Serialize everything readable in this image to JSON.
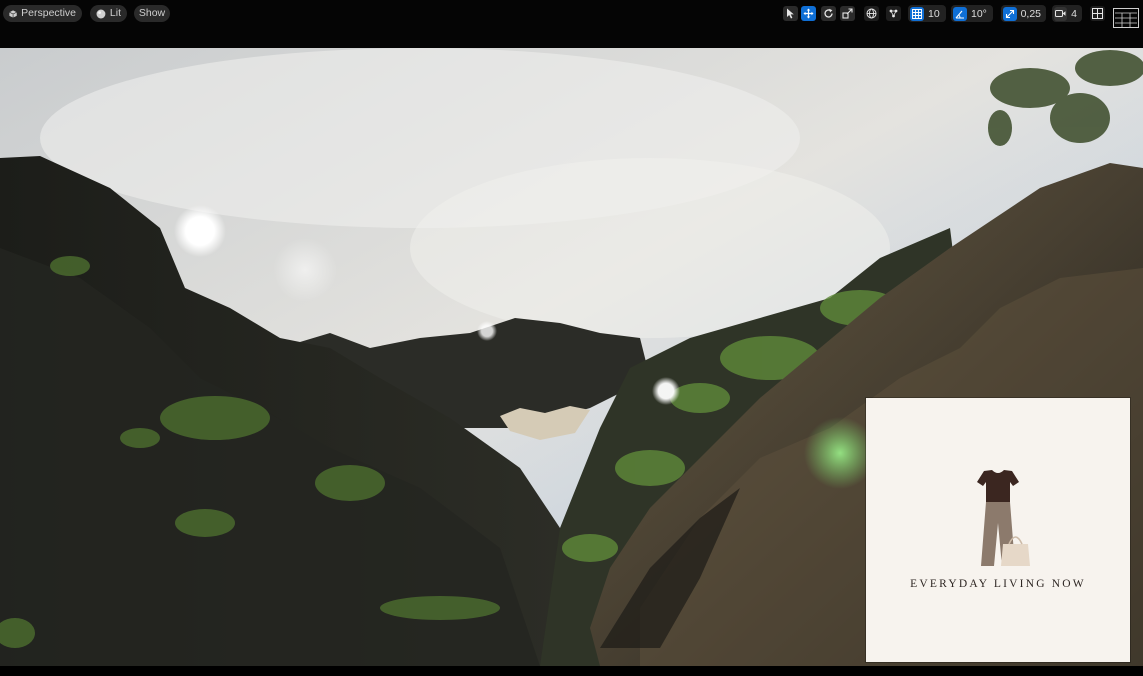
{
  "toolbar": {
    "view_mode": {
      "label": "Perspective",
      "icon": "cube-icon"
    },
    "lighting_mode": {
      "label": "Lit",
      "icon": "sphere-icon"
    },
    "show_menu": {
      "label": "Show"
    },
    "transform_tools": [
      "select-icon",
      "move-icon",
      "rotate-icon",
      "scale-icon"
    ],
    "world_space_icon": "globe-icon",
    "surface_snap_icon": "surface-snap-icon",
    "grid_snap": {
      "value": "10",
      "icon": "grid-icon"
    },
    "rotation_snap": {
      "value": "10°",
      "icon": "angle-icon"
    },
    "scale_snap": {
      "value": "0,25",
      "icon": "scale-snap-icon"
    },
    "camera_speed": {
      "value": "4",
      "icon": "camera-icon"
    },
    "viewport_options_icon": "viewport-grid-icon",
    "layout_icon": "viewport-layout-icon",
    "accent_color": "#0f6fd6"
  },
  "logo": {
    "text": "EVERYDAY LIVING NOW",
    "colors": {
      "top": "#3b2620",
      "pants": "#8c7a6c",
      "bag": "#e6d8c8",
      "background": "#f7f3ee"
    }
  }
}
